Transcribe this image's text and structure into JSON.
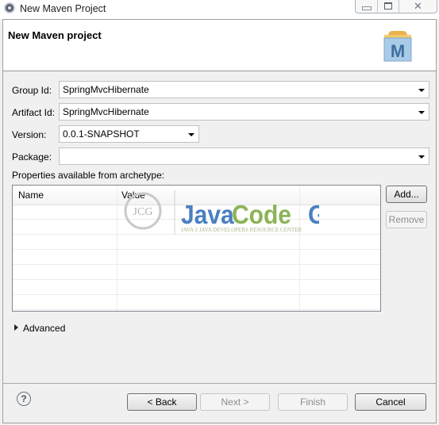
{
  "window": {
    "title": "New Maven Project",
    "controls": {
      "minimize": "minimize",
      "maximize": "maximize",
      "close": "close"
    }
  },
  "header": {
    "title": "New Maven project",
    "logo_letter": "M"
  },
  "form": {
    "group_id": {
      "label": "Group Id:",
      "value": "SpringMvcHibernate"
    },
    "artifact_id": {
      "label": "Artifact Id:",
      "value": "SpringMvcHibernate"
    },
    "version": {
      "label": "Version:",
      "value": "0.0.1-SNAPSHOT"
    },
    "package": {
      "label": "Package:",
      "value": ""
    },
    "properties_label": "Properties available from archetype:"
  },
  "properties_table": {
    "columns": [
      "Name",
      "Value"
    ],
    "rows": []
  },
  "side_buttons": {
    "add": "Add...",
    "remove": "Remove"
  },
  "advanced": {
    "label": "Advanced"
  },
  "watermark": {
    "badge": "JCG",
    "word1": "Java",
    "word2": "Code",
    "word3": "Geeks",
    "tagline": "JAVA 2 JAVA DEVELOPERS RESOURCE CENTER"
  },
  "footer": {
    "help": "?",
    "back": "< Back",
    "next": "Next >",
    "finish": "Finish",
    "cancel": "Cancel"
  },
  "colors": {
    "watermark_blue": "#4a7fc1",
    "watermark_green": "#8cb357"
  }
}
